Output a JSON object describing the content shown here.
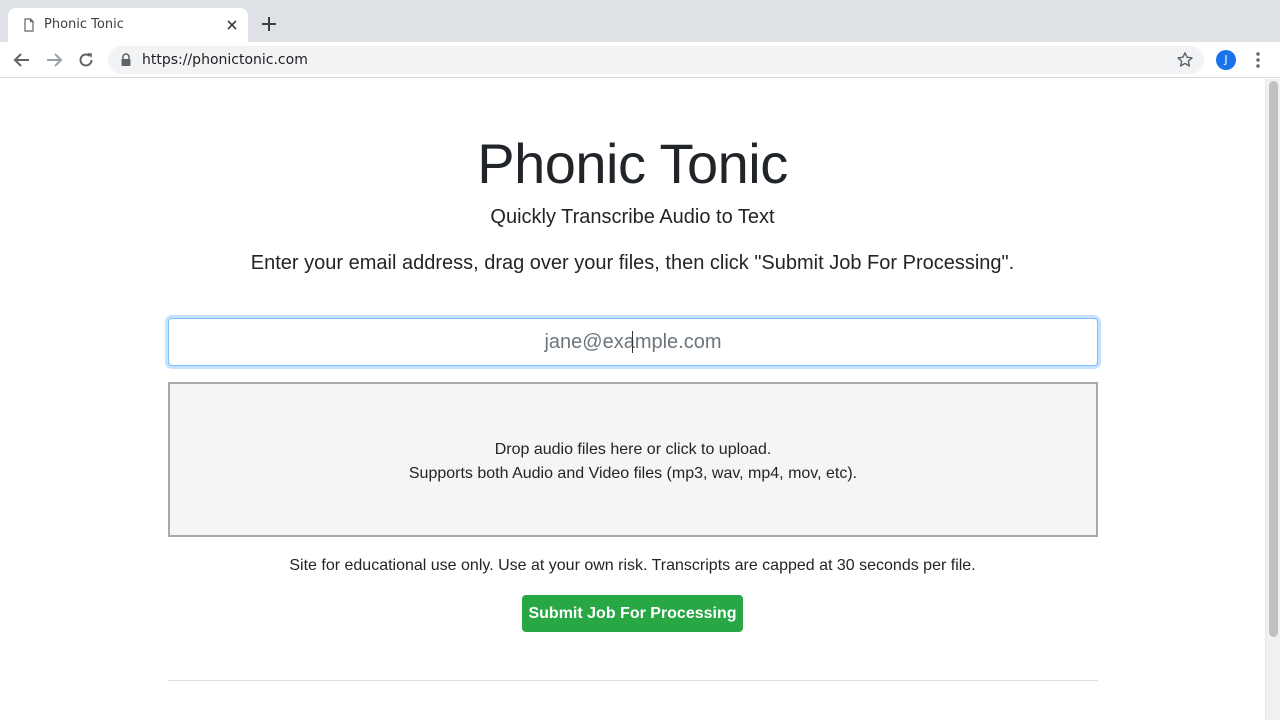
{
  "browser": {
    "tab_title": "Phonic Tonic",
    "url": "https://phonictonic.com",
    "avatar_initial": "J",
    "accent_color": "#1a73e8"
  },
  "page": {
    "title": "Phonic Tonic",
    "subtitle": "Quickly Transcribe Audio to Text",
    "instructions": "Enter your email address, drag over your files, then click \"Submit Job For Processing\".",
    "email_placeholder": "jane@example.com",
    "email_value": "",
    "dropzone_line1": "Drop audio files here or click to upload.",
    "dropzone_line2": "Supports both Audio and Video files (mp3, wav, mp4, mov, etc).",
    "disclaimer": "Site for educational use only. Use at your own risk. Transcripts are capped at 30 seconds per file.",
    "submit_label": "Submit Job For Processing",
    "submit_color": "#28a745"
  },
  "icons": [
    "page-icon",
    "close-icon",
    "plus-icon",
    "back-arrow-icon",
    "forward-arrow-icon",
    "reload-icon",
    "lock-icon",
    "star-icon",
    "kebab-menu-icon"
  ]
}
